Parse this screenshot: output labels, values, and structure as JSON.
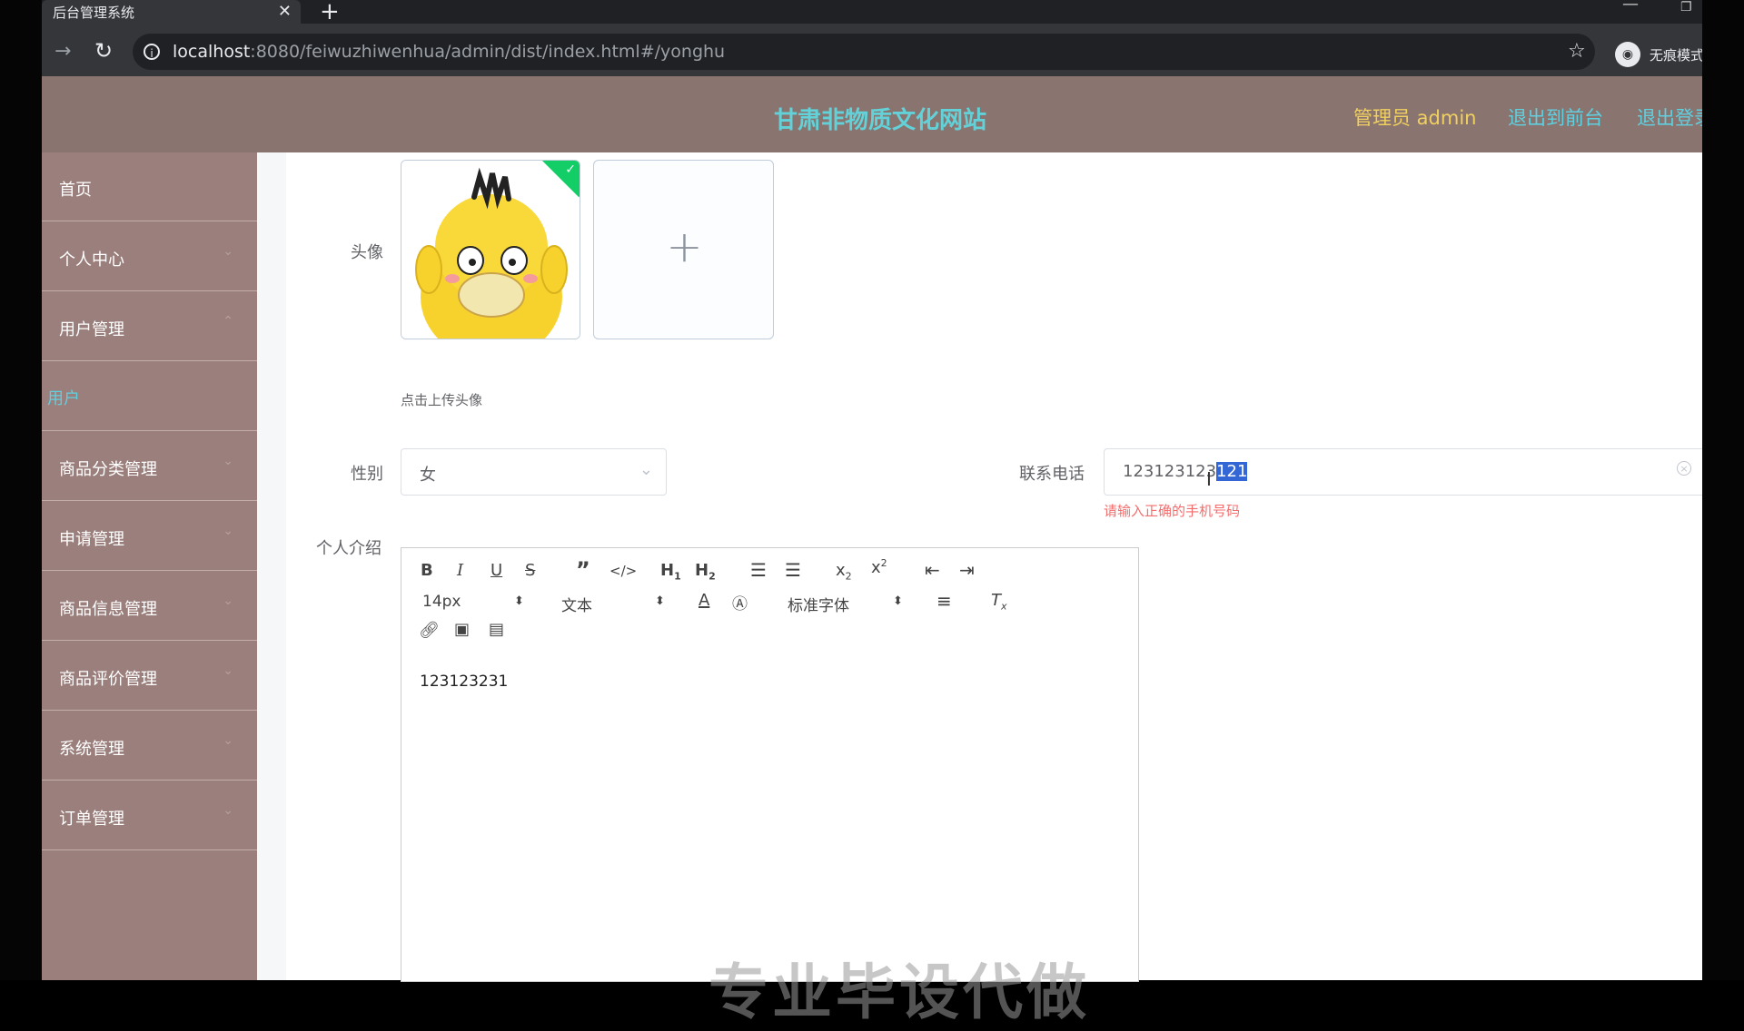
{
  "browser": {
    "tab_title": "后台管理系统",
    "tab_close": "✕",
    "new_tab": "+",
    "url_host": "localhost",
    "url_rest": ":8080/feiwuzhiwenhua/admin/dist/index.html#/yonghu",
    "profile_label": "无痕模式"
  },
  "header": {
    "title": "甘肃非物质文化网站",
    "admin": "管理员 admin",
    "to_front": "退出到前台",
    "logout": "退出登录"
  },
  "sidebar": {
    "items": [
      {
        "label": "首页"
      },
      {
        "label": "个人中心"
      },
      {
        "label": "用户管理"
      },
      {
        "label": "用户"
      },
      {
        "label": "商品分类管理"
      },
      {
        "label": "申请管理"
      },
      {
        "label": "商品信息管理"
      },
      {
        "label": "商品评价管理"
      },
      {
        "label": "系统管理"
      },
      {
        "label": "订单管理"
      }
    ]
  },
  "form": {
    "avatar_label": "头像",
    "upload_tip": "点击上传头像",
    "gender_label": "性别",
    "gender_value": "女",
    "phone_label": "联系电话",
    "phone_value_plain": "123123123",
    "phone_value_selected": "121",
    "phone_error": "请输入正确的手机号码",
    "intro_label": "个人介绍"
  },
  "editor": {
    "font_size": "14px",
    "header_select": "文本",
    "font_family": "标准字体",
    "content": "123123231"
  },
  "watermark": "专业毕设代做",
  "colors": {
    "header_bg": "#8a7470",
    "sidebar_bg": "#9b7f7c",
    "accent_cyan": "#5fd0e0",
    "admin_yellow": "#f0d060",
    "error_red": "#f56c6c"
  }
}
